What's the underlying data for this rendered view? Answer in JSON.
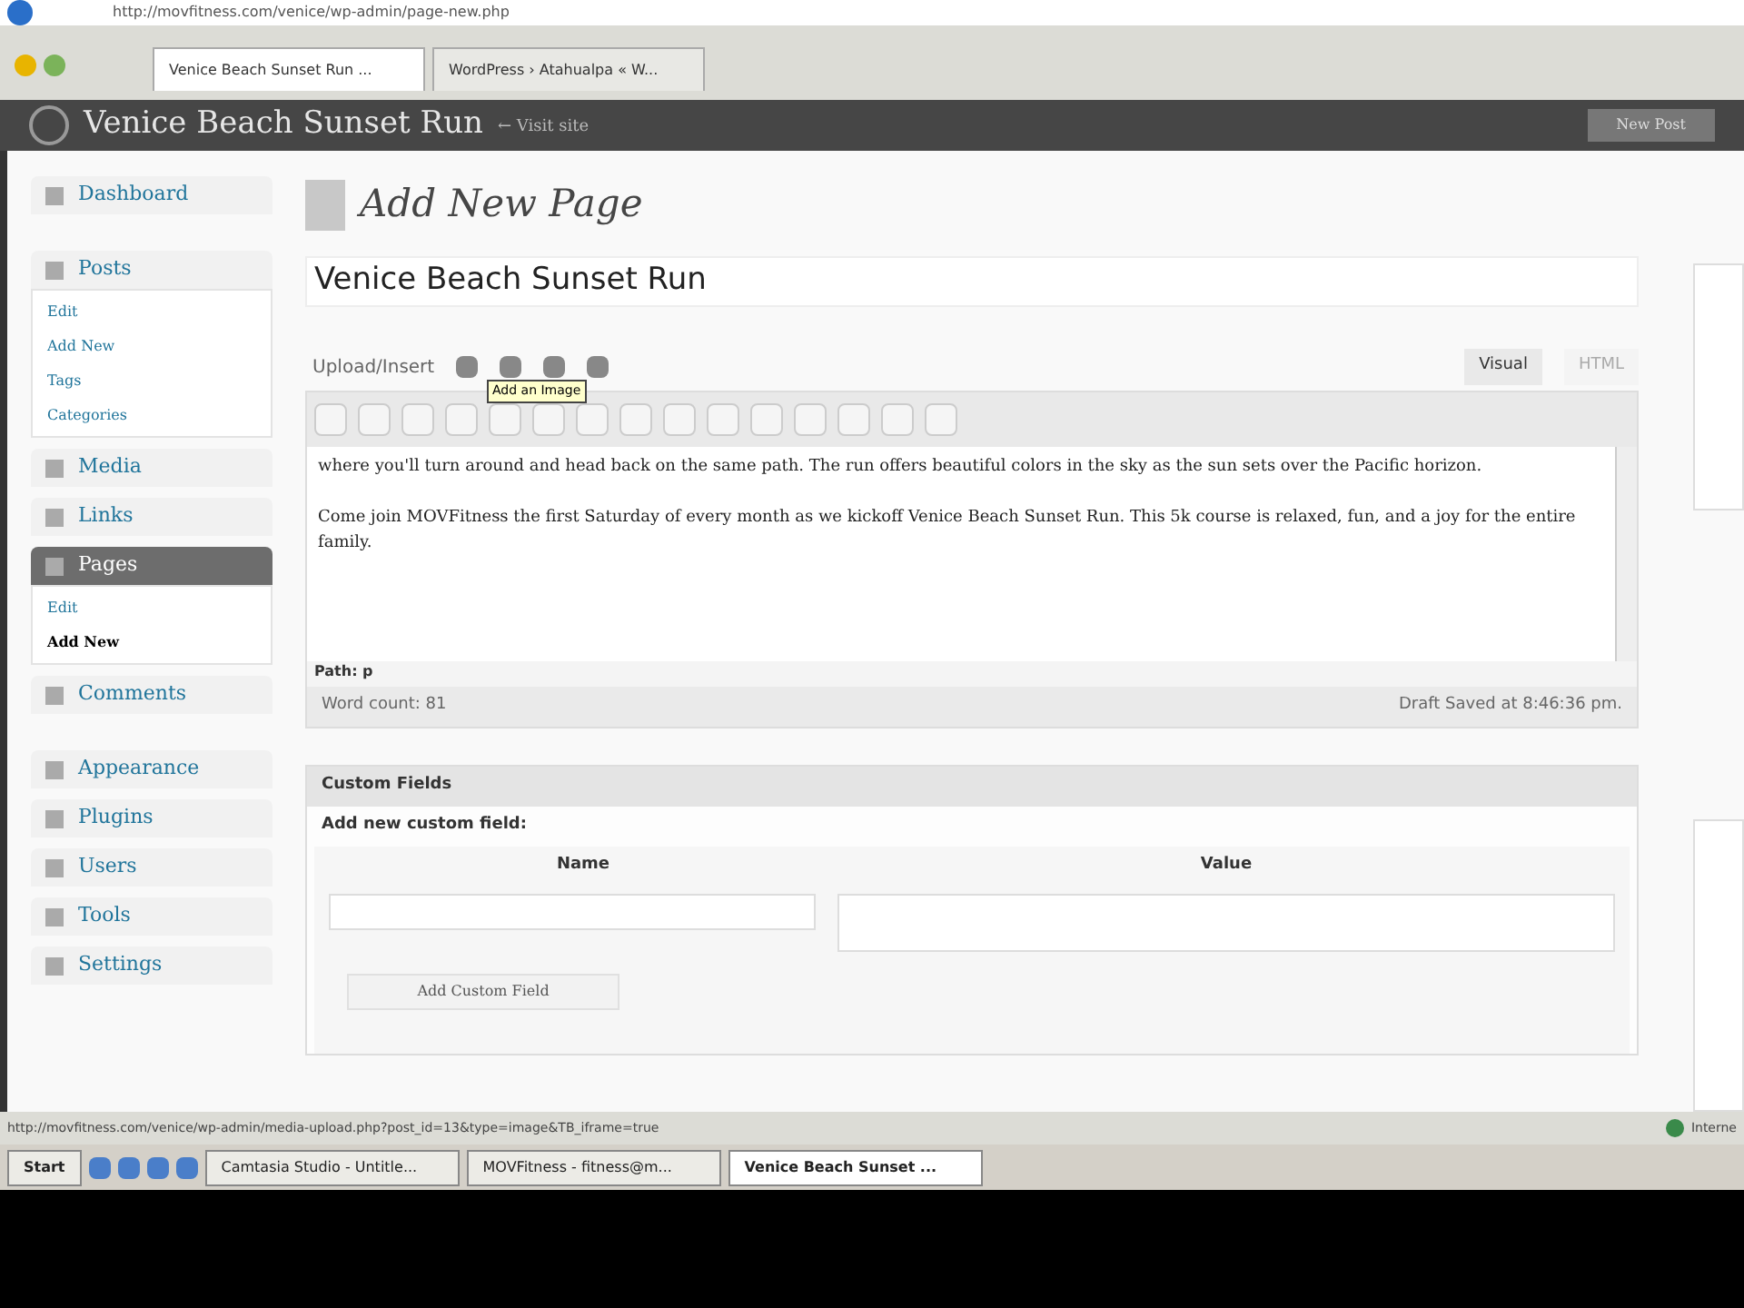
{
  "browser": {
    "address": "http://movfitness.com/venice/wp-admin/page-new.php",
    "tabs": [
      {
        "label": "Venice Beach Sunset Run ...",
        "selected": true
      },
      {
        "label": "WordPress › Atahualpa « W...",
        "selected": false
      }
    ]
  },
  "header": {
    "site_title": "Venice Beach Sunset Run",
    "visit_site": "← Visit site",
    "button": "New Post"
  },
  "sidebar": {
    "items": [
      {
        "label": "Dashboard",
        "selected": false
      },
      {
        "label": "Posts",
        "selected": false,
        "expanded": true,
        "children": [
          {
            "label": "Edit",
            "selected": false
          },
          {
            "label": "Add New",
            "selected": false
          },
          {
            "label": "Tags",
            "selected": false
          },
          {
            "label": "Categories",
            "selected": false
          }
        ]
      },
      {
        "label": "Media",
        "selected": false
      },
      {
        "label": "Links",
        "selected": false
      },
      {
        "label": "Pages",
        "selected": true,
        "expanded": true,
        "children": [
          {
            "label": "Edit",
            "selected": false
          },
          {
            "label": "Add New",
            "selected": true
          }
        ]
      },
      {
        "label": "Comments",
        "selected": false
      },
      {
        "label": "Appearance",
        "selected": false
      },
      {
        "label": "Plugins",
        "selected": false
      },
      {
        "label": "Users",
        "selected": false
      },
      {
        "label": "Tools",
        "selected": false
      },
      {
        "label": "Settings",
        "selected": false
      }
    ]
  },
  "page_heading": "Add New Page",
  "title_value": "Venice Beach Sunset Run",
  "editor": {
    "upload_label": "Upload/Insert",
    "tooltip": "Add an Image",
    "modes": [
      {
        "label": "Visual",
        "selected": true
      },
      {
        "label": "HTML",
        "selected": false
      }
    ],
    "paragraphs": [
      "where you'll turn around and head back on the same path.  The run offers beautiful colors in the sky as the sun sets over the Pacific horizon.",
      "Come join MOVFitness the first Saturday of every month as we kickoff Venice Beach Sunset Run.  This 5k course is relaxed, fun, and a joy for the entire family."
    ],
    "path": "Path: p",
    "word_count": "Word count: 81",
    "draft_saved": "Draft Saved at 8:46:36 pm."
  },
  "custom_fields": {
    "title": "Custom Fields",
    "subtitle": "Add new custom field:",
    "columns": [
      "Name",
      "Value"
    ],
    "button": "Add Custom Field"
  },
  "status_bar": {
    "url": "http://movfitness.com/venice/wp-admin/media-upload.php?post_id=13&type=image&TB_iframe=true",
    "zone": "Interne"
  },
  "taskbar": {
    "start": "Start",
    "tasks": [
      {
        "label": "Camtasia Studio - Untitle...",
        "selected": false
      },
      {
        "label": "MOVFitness - fitness@m...",
        "selected": false
      },
      {
        "label": "Venice Beach Sunset ...",
        "selected": true
      }
    ]
  }
}
